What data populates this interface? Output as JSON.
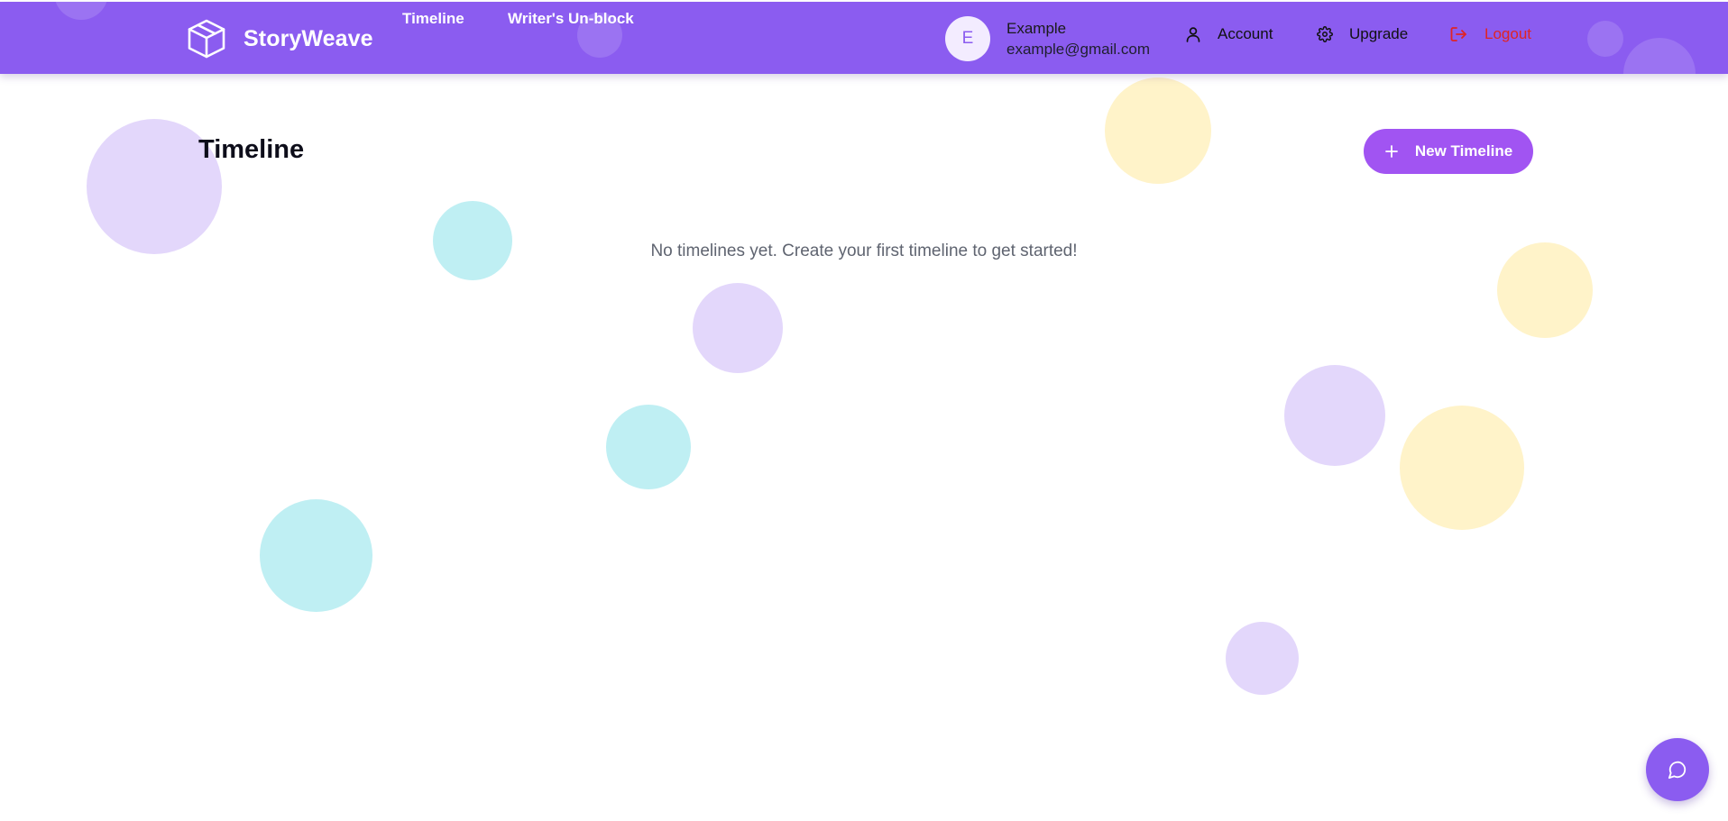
{
  "header": {
    "brand": "StoryWeave",
    "nav": [
      {
        "label": "Timeline"
      },
      {
        "label": "Writer's Un-block"
      }
    ],
    "user": {
      "avatar_initial": "E",
      "name": "Example",
      "email": "example@gmail.com"
    },
    "account_label": "Account",
    "upgrade_label": "Upgrade",
    "logout_label": "Logout"
  },
  "main": {
    "title": "Timeline",
    "new_button_label": "New Timeline",
    "empty_message": "No timelines yet. Create your first timeline to get started!"
  },
  "icons": {
    "brand": "cube-icon",
    "account": "user-icon",
    "upgrade": "gear-icon",
    "logout": "logout-icon",
    "new": "plus-icon",
    "chat": "chat-bubble-icon"
  },
  "colors": {
    "header": "#8b5cf0",
    "accent_button": "#a154f2",
    "logout": "#e02424",
    "bubble_purple": "#e3d7fb",
    "bubble_cyan": "#bfeff3",
    "bubble_yellow": "#fff3c9"
  }
}
